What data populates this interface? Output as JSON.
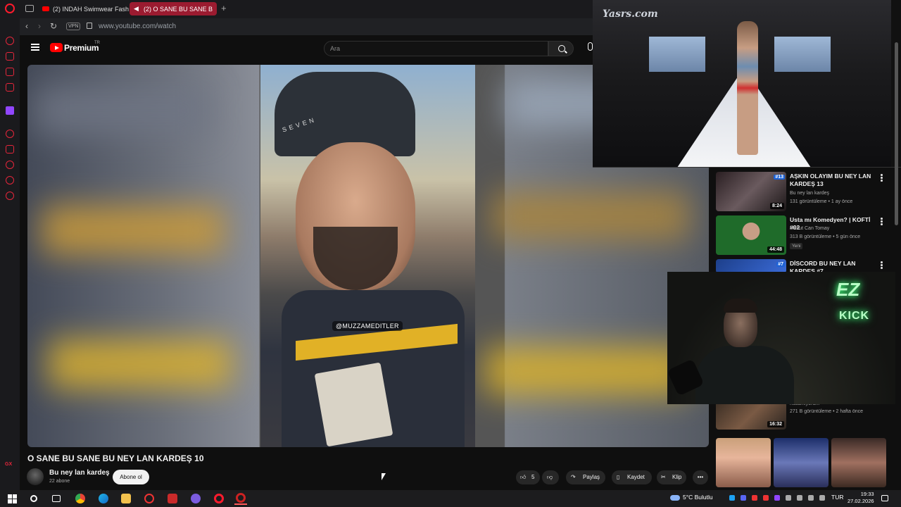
{
  "browser": {
    "tabs": [
      {
        "label": "(2) INDAH Swimwear Fash",
        "active": false
      },
      {
        "label": "(2) O SANE BU SANE B",
        "active": true
      }
    ],
    "vpn_label": "VPN",
    "url": "www.youtube.com/watch"
  },
  "youtube": {
    "brand": "Premium",
    "region": "TR",
    "search_placeholder": "Ara"
  },
  "video": {
    "watermark": "@MUZZAMEDITLER",
    "cap_text": "SEVEN",
    "title": "O SANE BU SANE BU NEY LAN KARDEŞ 10",
    "channel_name": "Bu ney lan kardeş",
    "subscribers": "22 abone",
    "subscribe_label": "Abone ol",
    "likes": "5",
    "share_label": "Paylaş",
    "save_label": "Kaydet",
    "clip_label": "Klip"
  },
  "pip_top": {
    "logo": "Yasrs.com"
  },
  "recommendations": [
    {
      "title": "AŞKIN OLAYIM BU NEY LAN KARDEŞ 13",
      "channel": "Bu ney lan kardeş",
      "meta": "131 görüntüleme • 1 ay önce",
      "duration": "8:24",
      "badge": "#13"
    },
    {
      "title": "Usta mı Komedyen? | KOFTİ #02",
      "channel": "Mesut Can Tomay",
      "meta": "313 B görüntüleme • 5 gün önce",
      "duration": "44:48",
      "tag": "Yeni"
    },
    {
      "title": "DİSCORD BU NEY LAN KARDEŞ #7",
      "badge": "#7"
    },
    {
      "channel": "nusamiyorum",
      "meta": "271 B görüntüleme • 2 hafta önce",
      "duration": "16:32"
    }
  ],
  "webcam": {
    "neon_top": "EZ",
    "neon_bottom": "KICK"
  },
  "taskbar": {
    "weather": "5°C  Bulutlu",
    "language": "TUR",
    "time": "19:33",
    "date": "27.02.2026"
  }
}
